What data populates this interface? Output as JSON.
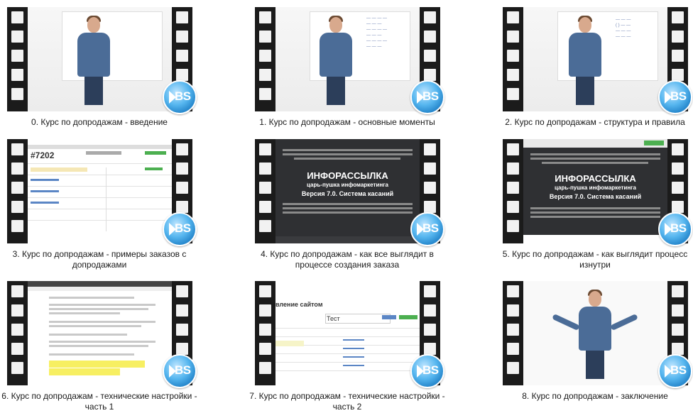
{
  "videos": [
    {
      "caption": "0. Курс по допродажам - введение",
      "frame": "whiteboard"
    },
    {
      "caption": "1. Курс по допродажам - основные моменты",
      "frame": "whiteboard-notes"
    },
    {
      "caption": "2. Курс по допродажам - структура и правила",
      "frame": "whiteboard-diagram"
    },
    {
      "caption": "3. Курс по допродажам - примеры заказов с допродажами",
      "frame": "order-screen",
      "order_no": "#7202"
    },
    {
      "caption": "4. Курс по допродажам - как все выглядит в процессе создания заказа",
      "frame": "landing",
      "heading": "ИНФОРАССЫЛКА",
      "sub1": "царь-пушка инфомаркетинга",
      "sub2": "Версия 7.0. Система касаний"
    },
    {
      "caption": "5. Курс по допродажам - как выглядит процесс изнутри",
      "frame": "landing",
      "heading": "ИНФОРАССЫЛКА",
      "sub1": "царь-пушка инфомаркетинга",
      "sub2": "Версия 7.0. Система касаний"
    },
    {
      "caption": "6. Курс по допродажам - технические настройки - часть 1",
      "frame": "document"
    },
    {
      "caption": "7. Курс по допродажам - технические настройки - часть 2",
      "frame": "crm",
      "title": "вление сайтом",
      "field": "Тест"
    },
    {
      "caption": "8. Курс по допродажам - заключение",
      "frame": "whiteboard-arms"
    }
  ],
  "badge_text": "BS",
  "icons": {
    "badge": "bs-logo-icon",
    "film": "film-strip-icon"
  },
  "colors": {
    "badge": "#1e7fc6",
    "film": "#1b1b1b",
    "caption": "#1a1a1a"
  }
}
